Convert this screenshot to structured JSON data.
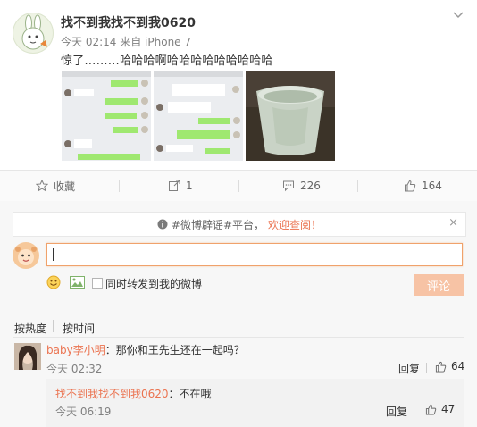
{
  "post": {
    "username": "找不到我找不到我0620",
    "time": "今天 02:14",
    "source": "来自 iPhone 7",
    "text": "惊了………哈哈哈啊哈哈哈哈哈哈哈哈哈"
  },
  "actions": {
    "favorite_label": "收藏",
    "repost_count": "1",
    "comment_count": "226",
    "like_count": "164"
  },
  "notice": {
    "text": "#微博辟谣#平台，",
    "link": "欢迎查阅！"
  },
  "composer": {
    "repost_checkbox_label": "同时转发到我的微博",
    "submit_label": "评论"
  },
  "sort": {
    "hot": "按热度",
    "time": "按时间"
  },
  "comments": [
    {
      "username": "baby李小明",
      "text": "：那你和王先生还在一起吗？",
      "time": "今天 02:32",
      "reply_label": "回复",
      "likes": "64",
      "replies": [
        {
          "username": "找不到我找不到我0620",
          "text": "：不在哦",
          "time": "今天 06:19",
          "reply_label": "回复",
          "likes": "47"
        }
      ]
    }
  ],
  "colors": {
    "accent": "#eb7350",
    "submit_bg": "#f7c3a5",
    "panel_bg": "#f7f7f7"
  }
}
